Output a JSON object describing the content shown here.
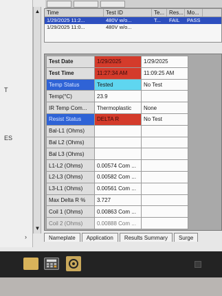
{
  "records": {
    "headers": [
      "Time",
      "Test ID",
      "Te...",
      "Res...",
      "Mo..."
    ],
    "rows": [
      {
        "time": "1/29/2025 11:2...",
        "test_id": "480V w/o...",
        "te": "T...",
        "res": "FAIL",
        "mo": "PASS",
        "selected": true
      },
      {
        "time": "1/29/2025 11:0...",
        "test_id": "480V w/o...",
        "te": "",
        "res": "",
        "mo": "",
        "selected": false
      }
    ]
  },
  "grid": {
    "rows": [
      {
        "label": "Test Date",
        "v1": "1/29/2025",
        "v2": "1/29/2025"
      },
      {
        "label": "Test Time",
        "v1": "11:27:34 AM",
        "v2": "11:09:25 AM"
      },
      {
        "label": "Temp Status",
        "v1": "Tested",
        "v2": "No Test"
      },
      {
        "label": "Temp(°C)",
        "v1": "23.9",
        "v2": ""
      },
      {
        "label": "IR Temp Com...",
        "v1": "Thermoplastic",
        "v2": "None"
      },
      {
        "label": "Resist Status",
        "v1": "DELTA R",
        "v2": "No Test"
      },
      {
        "label": "Bal-L1 (Ohms)",
        "v1": "",
        "v2": ""
      },
      {
        "label": "Bal L2 (Ohms)",
        "v1": "",
        "v2": ""
      },
      {
        "label": "Bal L3 (Ohms)",
        "v1": "",
        "v2": ""
      },
      {
        "label": "L1-L2 (Ohms)",
        "v1": "0.00574 Com ...",
        "v2": ""
      },
      {
        "label": "L2-L3 (Ohms)",
        "v1": "0.00582 Com ...",
        "v2": ""
      },
      {
        "label": "L3-L1 (Ohms)",
        "v1": "0.00561 Com ...",
        "v2": ""
      },
      {
        "label": "Max Delta R %",
        "v1": "3.727",
        "v2": ""
      },
      {
        "label": "Coil 1 (Ohms)",
        "v1": "0.00863 Com ...",
        "v2": ""
      },
      {
        "label": "Coil 2 (Ohms)",
        "v1": "0.00888 Com ...",
        "v2": ""
      }
    ]
  },
  "tabs": [
    "Nameplate",
    "Application",
    "Results Summary",
    "Surge"
  ],
  "left_strip": [
    "T",
    "ES"
  ],
  "colors": {
    "fail_red": "#d43b2b",
    "status_blue": "#2f63d6",
    "tested_cyan": "#5fd6f0",
    "selection_blue": "#2d4fbf"
  },
  "icons": [
    "scroll-up-icon",
    "scroll-down-icon",
    "folder-icon",
    "calculator-icon",
    "app-icon"
  ]
}
